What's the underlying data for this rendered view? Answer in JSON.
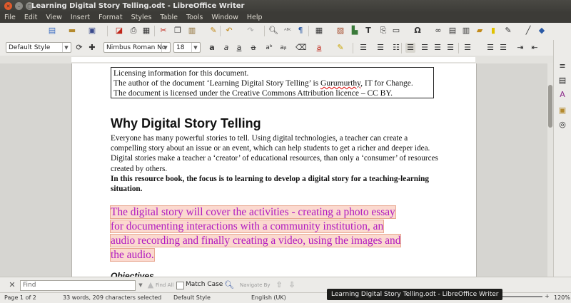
{
  "window": {
    "title": "Learning Digital Story Telling.odt - LibreOffice Writer"
  },
  "menu": [
    "File",
    "Edit",
    "View",
    "Insert",
    "Format",
    "Styles",
    "Table",
    "Tools",
    "Window",
    "Help"
  ],
  "formatting": {
    "paragraph_style": "Default Style",
    "font_name": "Nimbus Roman No",
    "font_size": "18"
  },
  "document": {
    "license_lines": [
      "Licensing information for this document.",
      "The author of the document ‘Learning Digital Story Telling’ is ",
      "The document is licensed under the Creative Commons Attribution licence – CC BY."
    ],
    "license_author": "Gurumurthy",
    "license_line2_tail": ", IT for Change.",
    "heading": "Why Digital Story Telling",
    "paragraph": "Everyone has many powerful stories to tell. Using digital technologies, a teacher can create a compelling story about an issue or an event, which can help students to get a richer and deeper idea. Digital stories make a teacher a ‘creator’ of educational resources, than only a ‘consumer’ of resources created by others.",
    "bold_paragraph": "In this resource book, the focus is to learning to develop a digital story for a teaching-learning situation.",
    "highlighted_lines": [
      "The digital story will cover the activities - creating a photo essay",
      "for documenting interactions with a community institution, an",
      "audio recording and finally creating a video, using the images and",
      "the audio."
    ],
    "next_heading": "Objectives"
  },
  "findbar": {
    "placeholder": "Find",
    "find_all": "Find All",
    "match_case": "Match Case",
    "navigate_by": "Navigate By"
  },
  "status": {
    "page": "Page 1 of 2",
    "selection": "33 words, 209 characters selected",
    "style": "Default Style",
    "language": "English (UK)",
    "zoom": "120%"
  },
  "tooltip": "Learning Digital Story Telling.odt - LibreOffice Writer",
  "colors": {
    "highlight_text": "#b018c0",
    "highlight_bg": "#fbd9cf",
    "titlebar": "#3c3b37",
    "close_button": "#e05a2b"
  }
}
